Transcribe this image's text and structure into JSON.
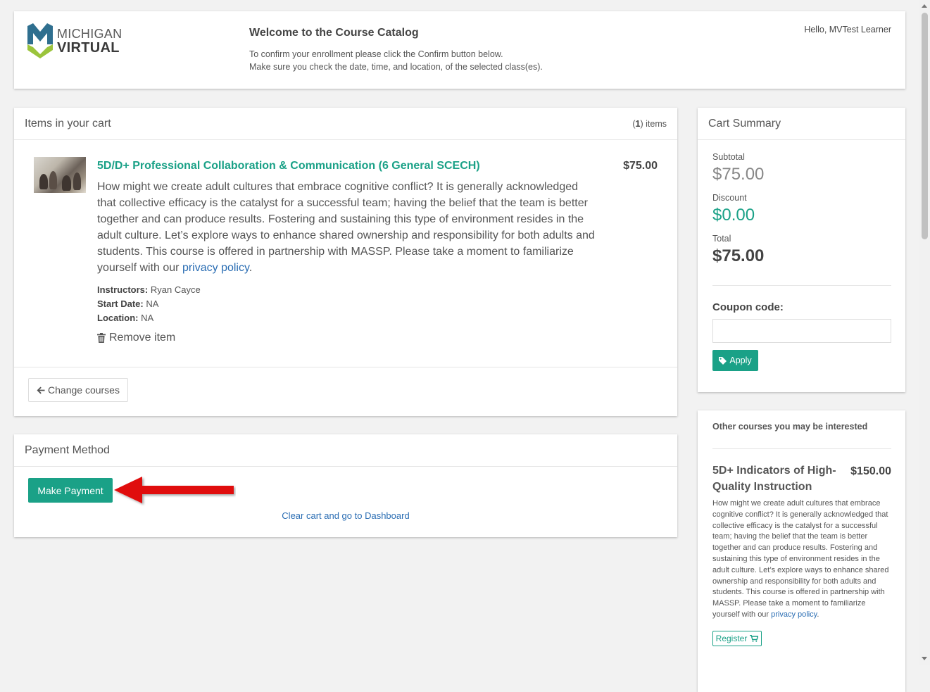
{
  "header": {
    "logo_line1": "MICHIGAN",
    "logo_line2": "VIRTUAL",
    "welcome_title": "Welcome to the Course Catalog",
    "welcome_line1": "To confirm your enrollment please click the Confirm button below.",
    "welcome_line2": "Make sure you check the date, time, and location, of the selected class(es).",
    "greeting": "Hello, MVTest Learner"
  },
  "cart": {
    "title": "Items in your cart",
    "count_open": "(",
    "count": "1",
    "count_close": ") items",
    "item": {
      "title": "5D/D+ Professional Collaboration & Communication (6 General SCECH)",
      "price": "$75.00",
      "description": "How might we create adult cultures that embrace cognitive conflict? It is generally acknowledged that collective efficacy is the catalyst for a successful team; having the belief that the team is better together and can produce results. Fostering and sustaining this type of environment resides in the adult culture. Let’s explore ways to enhance shared ownership and responsibility for both adults and students. This course is offered in partnership with MASSP. Please take a moment to familiarize yourself with our ",
      "privacy_link": "privacy policy",
      "desc_end": ".",
      "instructors_label": "Instructors:",
      "instructors": "Ryan Cayce",
      "start_label": "Start Date:",
      "start": "NA",
      "location_label": "Location:",
      "location": "NA",
      "remove_label": "Remove item"
    },
    "change_courses_label": "Change courses"
  },
  "payment": {
    "title": "Payment Method",
    "make_payment_label": "Make Payment",
    "clear_cart_label": "Clear cart and go to Dashboard"
  },
  "summary": {
    "title": "Cart Summary",
    "subtotal_label": "Subtotal",
    "subtotal": "$75.00",
    "discount_label": "Discount",
    "discount": "$0.00",
    "total_label": "Total",
    "total": "$75.00",
    "coupon_label": "Coupon code:",
    "coupon_value": "",
    "apply_label": "Apply"
  },
  "other": {
    "heading": "Other courses you may be interested",
    "course": {
      "title": "5D+ Indicators of High-Quality Instruction",
      "price": "$150.00",
      "description": "How might we create adult cultures that embrace cognitive conflict? It is generally acknowledged that collective efficacy is the catalyst for a successful team; having the belief that the team is better together and can produce results. Fostering and sustaining this type of environment resides in the adult culture. Let’s explore ways to enhance shared ownership and responsibility for both adults and students. This course is offered in partnership with MASSP. Please take a moment to familiarize yourself with our ",
      "privacy_link": "privacy policy",
      "desc_end": ".",
      "register_label": "Register"
    }
  },
  "colors": {
    "accent": "#1aa187",
    "link": "#2a6db3",
    "arrow": "#e01010"
  },
  "icons": {
    "remove": "trash-icon",
    "change_courses": "arrow-left-icon",
    "apply": "tag-icon",
    "register": "cart-icon"
  }
}
